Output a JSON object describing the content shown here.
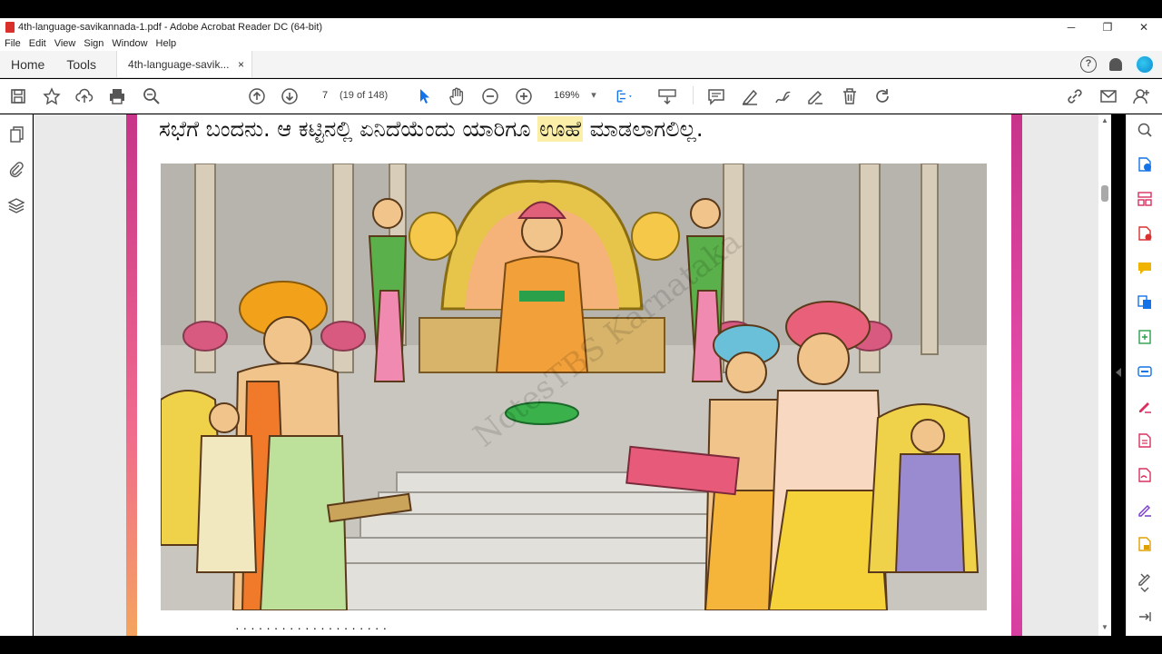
{
  "window": {
    "title": "4th-language-savikannada-1.pdf - Adobe Acrobat Reader DC (64-bit)",
    "controls": {
      "minimize": "─",
      "restore": "❐",
      "close": "✕"
    }
  },
  "menu": [
    "File",
    "Edit",
    "View",
    "Sign",
    "Window",
    "Help"
  ],
  "tabs": {
    "home": "Home",
    "tools": "Tools",
    "document": "4th-language-savik...",
    "close": "×"
  },
  "toolbar": {
    "page_number": "7",
    "page_count": "(19 of 148)",
    "zoom": "169%",
    "zoom_arrow": "▾"
  },
  "document": {
    "heading_prefix": "ಸಭೆಗೆ ಬಂದನು. ಆ ಕಟ್ಟಿನಲ್ಲಿ ಏನಿದೆಯೆಂದು ಯಾರಿಗೂ ",
    "heading_highlight": "ಊಹೆ",
    "heading_suffix": " ಮಾಡಲಾಗಲಿಲ್ಲ.",
    "watermark": "NotesTBS Karnataka",
    "next_line": "· ·  ·  ·  ·   · · ·  · · ·   ·  ·  ·   ·  ·   ·  · · ·"
  },
  "colors": {
    "page_border": "#c7348a",
    "highlight": "#fbeea8",
    "acrobat_red": "#d9302c",
    "accent_blue": "#1473e6"
  }
}
